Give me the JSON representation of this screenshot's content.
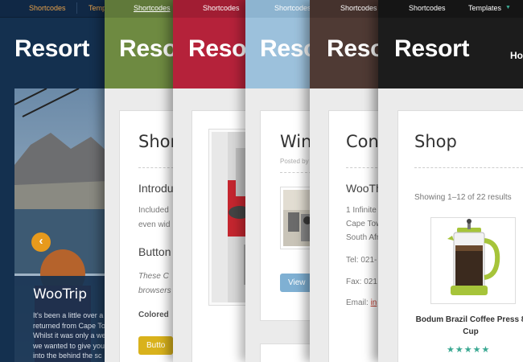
{
  "brand": "Resort",
  "panels": {
    "navy": {
      "nav": [
        "Shortcodes",
        "Templ"
      ],
      "slide_title": "WooTrip",
      "slide_text": [
        "It's been a little over a",
        "returned from Cape To",
        "Whilst it was only a we",
        "we wanted to give you",
        "into the behind the sc"
      ]
    },
    "olive": {
      "nav": [
        "Shortcodes"
      ],
      "title": "Shor",
      "intro": "Introdu",
      "intro_text": [
        "Included",
        "even wid"
      ],
      "buttons_heading": "Button",
      "buttons_text": [
        "These C",
        "browsers"
      ],
      "colored": "Colored",
      "button_label": "Butto"
    },
    "crimson": {
      "nav": [
        "Shortcodes"
      ]
    },
    "lightblue": {
      "nav": [
        "Shortcodes"
      ],
      "title": "Win",
      "posted_by": "Posted by",
      "view_button": "View"
    },
    "brown": {
      "nav": [
        "Shortcodes"
      ],
      "title": "Cont",
      "company": "WooTh",
      "address": [
        "1 Infinite",
        "Cape Tow",
        "South Afr"
      ],
      "tel": "Tel: 021-",
      "fax": "Fax: 021",
      "email_label": "Email:",
      "email_link": "in"
    },
    "black": {
      "nav": [
        "Shortcodes",
        "Templates"
      ],
      "menu_item": "Ho",
      "title": "Shop",
      "results": "Showing 1–12 of 22 results",
      "product_name": [
        "Bodum Brazil Coffee Press 8",
        "Cup"
      ],
      "rating_stars": "★★★★★"
    }
  },
  "colors": {
    "navy": "#14304f",
    "olive": "#6e8a41",
    "crimson": "#b5223a",
    "lightblue": "#9cc1dc",
    "brown": "#4f3a34",
    "black": "#1c1c1c",
    "nav_orange": "#e8a24a",
    "button_yellow": "#d9b21c",
    "button_blue": "#7fb0d3",
    "link_red": "#c0392b",
    "star_teal": "#3aa892"
  }
}
